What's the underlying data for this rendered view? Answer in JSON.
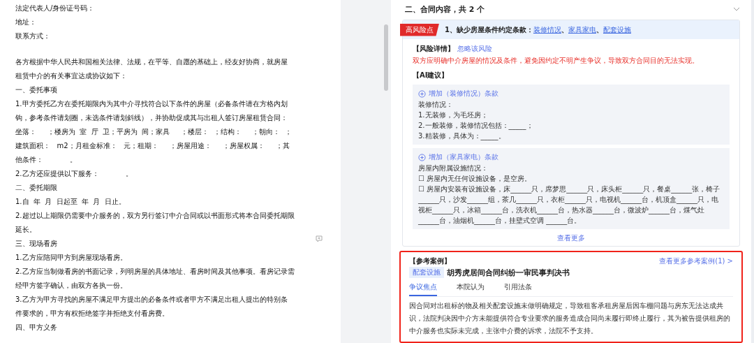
{
  "document": {
    "lines": [
      {
        "text": "法定代表人/身份证号码："
      },
      {
        "text": "地址："
      },
      {
        "text": "联系方式："
      },
      {
        "text": "各方根据中华人民共和国相关法律、法规，在平等、自愿的基础上，经友好协商，就房屋",
        "gap_before": true
      },
      {
        "text": "租赁中介的有关事宜达成协议如下："
      },
      {
        "text": "一、委托事项"
      },
      {
        "text": "1.甲方委托乙方在委托期限内为其中介寻找符合以下条件的房屋（必备条件请在方格内划"
      },
      {
        "text": "钩，参考条件请划圈，未选条件请划斜线），并协助促成其与出租人签订房屋租赁合同："
      },
      {
        "text": "坐落：     ；楼房为  室  厅  卫；平房为  间；家具     ；楼层：  ；结构：     ；朝向：  ；"
      },
      {
        "text": "建筑面积：   m2；月租金标准：   元；租期：     ；房屋用途：     ；房屋权属：     ；其"
      },
      {
        "text": "他条件：            。"
      },
      {
        "text": "2.乙方还应提供以下服务：            。"
      },
      {
        "text": "二、委托期限"
      },
      {
        "text": "1.自  年  月  日起至  年  月  日止。"
      },
      {
        "text": "2.超过以上期限仍需要中介服务的，双方另行签订中介合同或以书面形式将本合同委托期限"
      },
      {
        "text": "延长。"
      },
      {
        "text": "三、现场看房"
      },
      {
        "text": "1.乙方应陪同甲方到房屋现场看房。"
      },
      {
        "text": "2.乙方应当制做看房的书面记录，列明房屋的具体地址、看房时间及其他事项。看房记录需"
      },
      {
        "text": "经甲方签字确认，由双方各执一份。"
      },
      {
        "text": "3.乙方为甲方寻找的房屋不满足甲方提出的必备条件或者甲方不满足出租人提出的特别条"
      },
      {
        "text": "件要求的，甲方有权拒绝签字并拒绝支付看房费。"
      },
      {
        "text": "四、甲方义务"
      }
    ]
  },
  "review_panel": {
    "section_title": "二、合同内容，共 2 个",
    "expanded": true,
    "risk": {
      "tag": "高风险点",
      "title": "1、缺少房屋条件约定条款：",
      "links": [
        "装修情况",
        "家具家电",
        "配套设施"
      ],
      "link_separator": "、",
      "detail_label": "【风险详情】",
      "ignore_link": "忽略该风险",
      "detail_text": "双方应明确中介房屋的情况及条件，避免因约定不明产生争议，导致双方合同目的无法实现。",
      "suggestion_label": "【AI建议】",
      "suggestions": [
        {
          "action": "增加（装修情况）条款",
          "lines": [
            "装修情况：",
            "1.无装修，为毛坯房；",
            "2.一般装修，装修情况包括：_____；",
            "3.精装修，具体为：_____。"
          ]
        },
        {
          "action": "增加（家具家电）条款",
          "lines": [
            "房屋内附属设施情况：",
            "☐ 房屋内无任何设施设备，是空房。",
            "☐ 房屋内安装有设施设备，床______只，席梦思______只，床头柜______只，餐桌______张，椅子______只，沙发______组，茶几______只，衣柜______只，电视机______台，机顶盒______只，电视柜______只，冰箱______台，洗衣机______台，热水器______台，微波炉______台，煤气灶______台，油烟机______台，挂壁式空调  ______台。"
          ]
        }
      ],
      "more_link": "查看更多"
    },
    "reference": {
      "highlighted": true,
      "label": "【参考案例】",
      "more_link": "查看更多参考案例(1) >",
      "tag": "配套设施",
      "title": "胡秀虎居间合同纠纷一审民事判决书",
      "tabs": [
        {
          "label": "争议焦点",
          "selected": true
        },
        {
          "label": "本院认为",
          "selected": false
        },
        {
          "label": "引用法条",
          "selected": false
        }
      ],
      "text": "因合同对出租标的物及相关配套设施未做明确规定，导致租客承租房屋后因车棚问题与房东无法达成共识，法院判决因中介方未能提供符合专业要求的服务造成合同尚未履行即终止履行，其为被告提供租房的中介服务也实际未完成，主张中介费的诉求，法院不予支持。"
    }
  }
}
